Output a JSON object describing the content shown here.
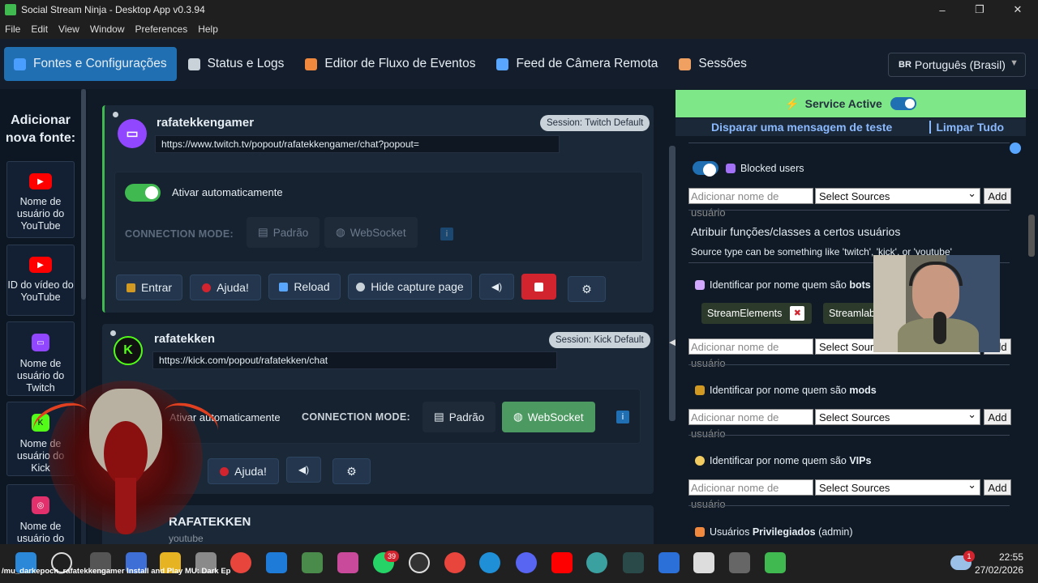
{
  "window": {
    "title": "Social Stream Ninja - Desktop App v0.3.94",
    "minimize": "–",
    "maximize": "❐",
    "close": "✕"
  },
  "menu": [
    "File",
    "Edit",
    "View",
    "Window",
    "Preferences",
    "Help"
  ],
  "tabs": [
    {
      "label": "Fontes e Configurações",
      "icon": "sliders-icon",
      "color": "#4a9eff"
    },
    {
      "label": "Status e Logs",
      "icon": "log-icon",
      "color": "#c9d1d9"
    },
    {
      "label": "Editor de Fluxo de Eventos",
      "icon": "flow-icon",
      "color": "#f0883e"
    },
    {
      "label": "Feed de Câmera Remota",
      "icon": "camera-icon",
      "color": "#58a6ff"
    },
    {
      "label": "Sessões",
      "icon": "people-icon",
      "color": "#f0a060"
    }
  ],
  "language": {
    "flag": "BR",
    "label": "Português (Brasil)"
  },
  "sidebar": {
    "title": "Adicionar nova fonte:",
    "items": [
      {
        "label": "Nome de usuário do YouTube",
        "icon": "youtube-icon",
        "color": "#ff0000"
      },
      {
        "label": "ID do vídeo do YouTube",
        "icon": "youtube-icon",
        "color": "#ff0000"
      },
      {
        "label": "Nome de usuário do Twitch",
        "icon": "twitch-icon",
        "color": "#9146ff"
      },
      {
        "label": "Nome de usuário do Kick",
        "icon": "kick-icon",
        "color": "#53fc18"
      },
      {
        "label": "Nome de usuário do",
        "icon": "instagram-icon",
        "color": "#e1306c"
      }
    ]
  },
  "sources": [
    {
      "name": "rafatekkengamer",
      "url": "https://www.twitch.tv/popout/rafatekkengamer/chat?popout=",
      "session": "Session: Twitch Default",
      "auto_label": "Ativar automaticamente",
      "mode_label": "CONNECTION MODE:",
      "mode_default": "Padrão",
      "mode_ws": "WebSocket",
      "info": "i",
      "buttons": [
        "Entrar",
        "Ajuda!",
        "Reload",
        "Hide capture page"
      ]
    },
    {
      "name": "rafatekken",
      "url": "https://kick.com/popout/rafatekken/chat",
      "session": "Session: Kick Default",
      "auto_label": "Ativar automaticamente",
      "mode_label": "CONNECTION MODE:",
      "mode_default": "Padrão",
      "mode_ws": "WebSocket",
      "info": "i",
      "buttons": [
        "Ajuda!"
      ]
    },
    {
      "name": "RAFATEKKEN",
      "sub": "youtube"
    }
  ],
  "right": {
    "service": "Service Active",
    "test_msg": "Disparar uma mensagem de teste",
    "clear_all": "Limpar Tudo",
    "blocked": "Blocked users",
    "input_placeholder": "Adicionar nome de usuário",
    "select": "Select Sources",
    "add": "Add",
    "roles_title": "Atribuir funções/classes a certos usuários",
    "roles_desc": "Source type can be something like 'twitch', 'kick', or 'youtube'",
    "bots_prefix": "Identificar por nome quem são",
    "bots": "bots",
    "bot_chips": [
      "StreamElements",
      "Streamlabs"
    ],
    "mods_prefix": "Identificar por nome quem são",
    "mods": "mods",
    "vips_prefix": "Identificar por nome quem são",
    "vips": "VIPs",
    "priv_prefix": "Usuários",
    "priv": "Privilegiados",
    "priv_suffix": "(admin)"
  },
  "taskbar": {
    "title": "/mu_darkepoch_rafatekkengamer Install and Play MU: Dark Ep",
    "time": "22:55",
    "date": "27/02/2026",
    "badge_whatsapp": "39",
    "badge_notif": "1"
  },
  "colors": {
    "accent": "#1f6fb2",
    "service": "#7ee787",
    "active_border": "#3fb950",
    "websocket": "#4c9a61",
    "stop": "#d1242f"
  }
}
